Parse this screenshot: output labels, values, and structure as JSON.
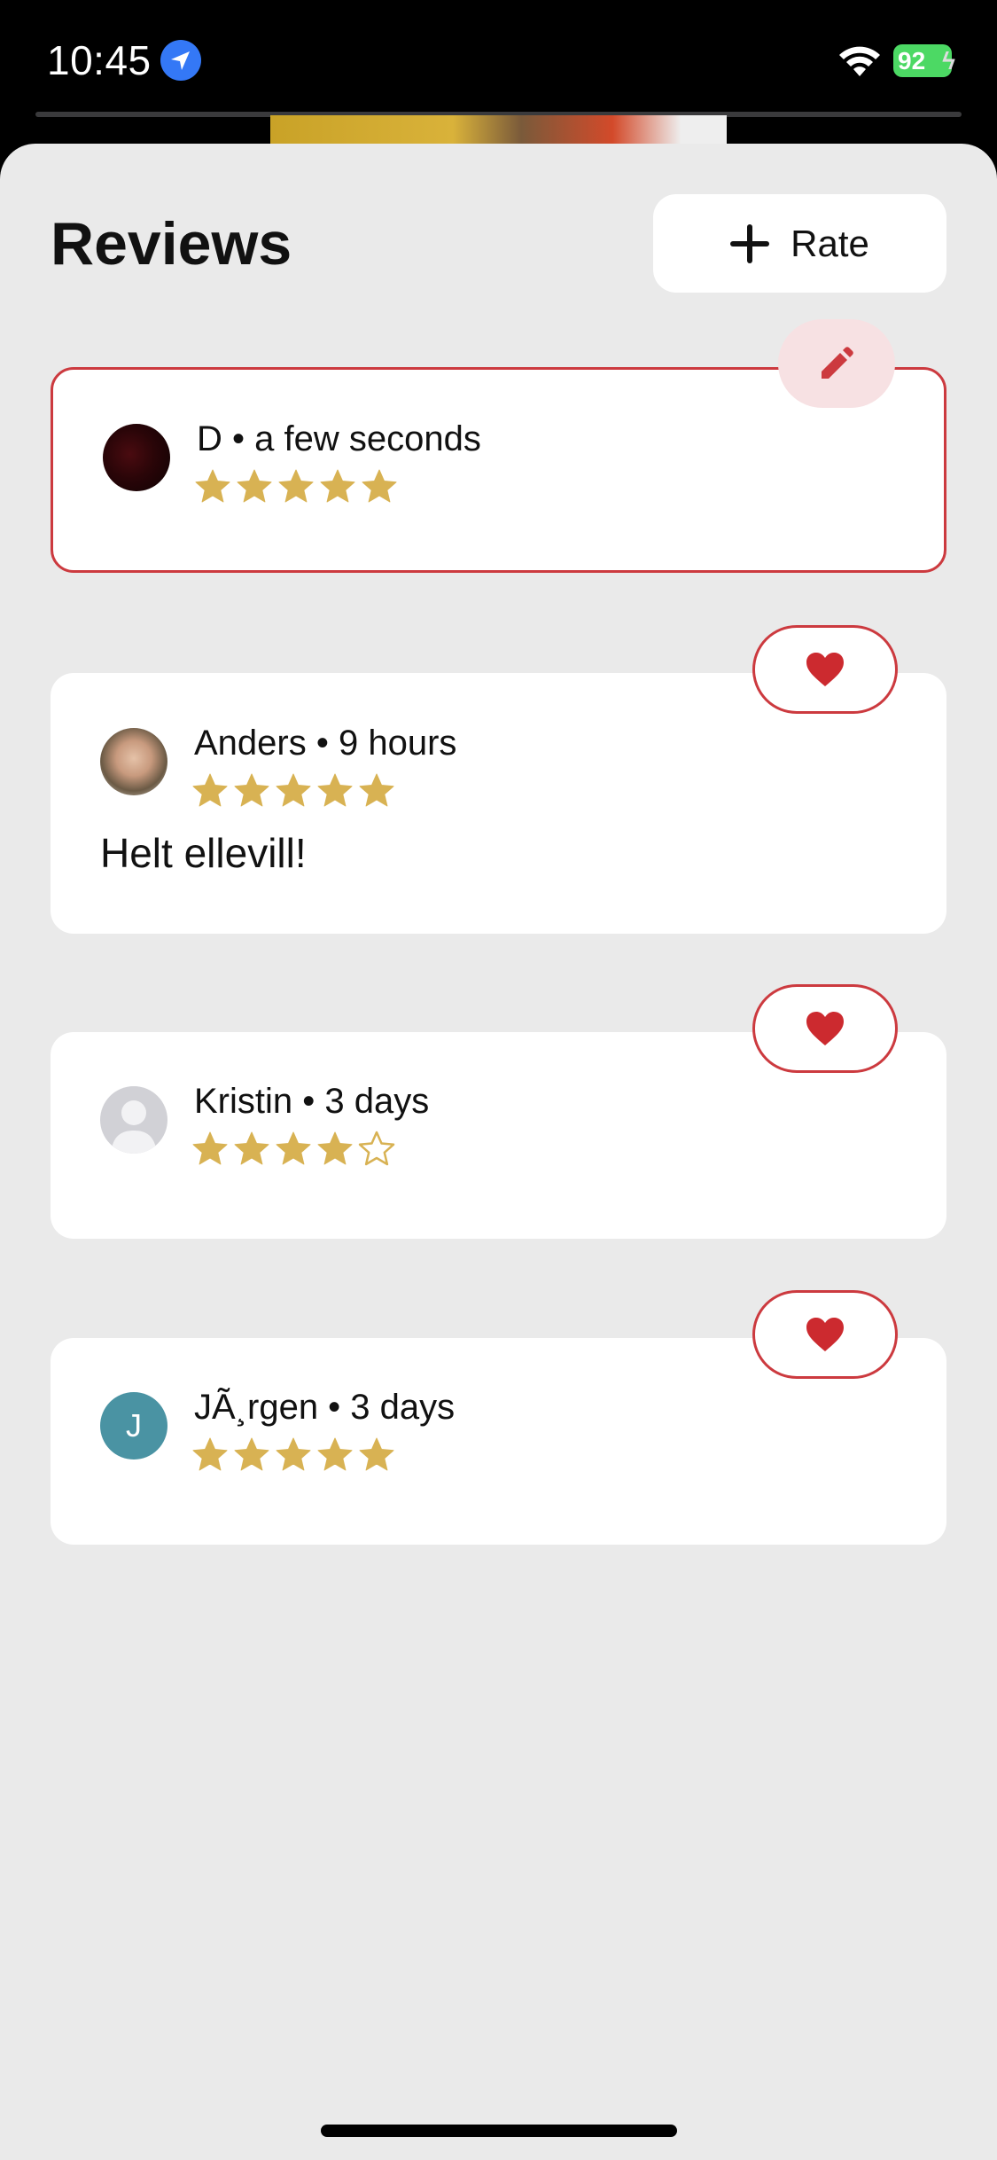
{
  "status_bar": {
    "time": "10:45",
    "battery": "92",
    "icons": [
      "location-arrow-icon",
      "wifi-icon",
      "battery-charging-icon"
    ]
  },
  "sheet": {
    "title": "Reviews",
    "rate_label": "Rate"
  },
  "reviews": [
    {
      "author": "D",
      "age": "a few seconds",
      "meta": "D • a few seconds",
      "rating": 5,
      "comment": "",
      "own": true,
      "action_icon": "pencil-icon",
      "avatar_type": "photo"
    },
    {
      "author": "Anders",
      "age": "9 hours",
      "meta": "Anders • 9 hours",
      "rating": 5,
      "comment": "Helt ellevill!",
      "own": false,
      "action_icon": "heart-icon",
      "avatar_type": "photo"
    },
    {
      "author": "Kristin",
      "age": "3 days",
      "meta": "Kristin • 3 days",
      "rating": 4,
      "comment": "",
      "own": false,
      "action_icon": "heart-icon",
      "avatar_type": "placeholder"
    },
    {
      "author": "JÃ¸rgen",
      "age": "3 days",
      "meta": "JÃ¸rgen • 3 days",
      "rating": 5,
      "comment": "",
      "own": false,
      "action_icon": "heart-icon",
      "avatar_type": "initial",
      "avatar_initial": "J"
    }
  ],
  "colors": {
    "accent_red": "#cc3a3f",
    "star_gold": "#d8b253",
    "sheet_bg": "#eaeaea",
    "initial_avatar_bg": "#4a93a3"
  }
}
